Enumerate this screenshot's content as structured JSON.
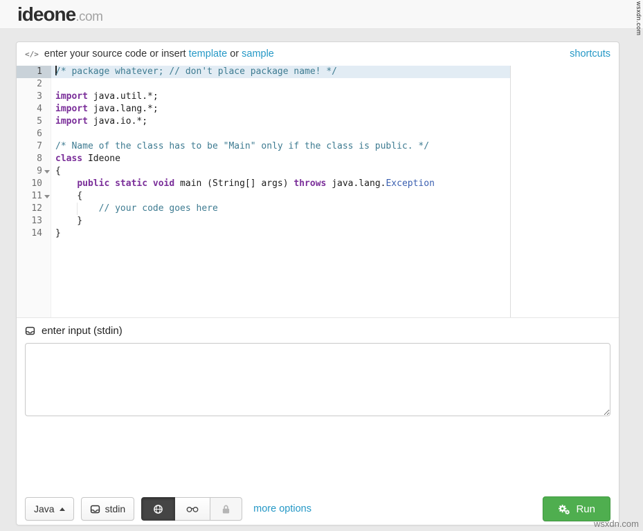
{
  "watermark": {
    "text": "wsxdn.com"
  },
  "header": {
    "logo_main": "ideone",
    "logo_suffix": ".com"
  },
  "source_bar": {
    "code_icon": "</>",
    "prefix": "enter your source code or insert",
    "template_link": "template",
    "or_text": "or",
    "sample_link": "sample",
    "shortcuts_link": "shortcuts"
  },
  "editor": {
    "language": "java",
    "lines": [
      {
        "n": 1,
        "active": true,
        "cursor": true,
        "tokens": [
          {
            "t": "/* package whatever; // don't place package name! */",
            "c": "com"
          }
        ]
      },
      {
        "n": 2,
        "tokens": []
      },
      {
        "n": 3,
        "tokens": [
          {
            "t": "import",
            "c": "kw"
          },
          {
            "t": " java.util.*;",
            "c": "pl"
          }
        ]
      },
      {
        "n": 4,
        "tokens": [
          {
            "t": "import",
            "c": "kw"
          },
          {
            "t": " java.lang.*;",
            "c": "pl"
          }
        ]
      },
      {
        "n": 5,
        "tokens": [
          {
            "t": "import",
            "c": "kw"
          },
          {
            "t": " java.io.*;",
            "c": "pl"
          }
        ]
      },
      {
        "n": 6,
        "tokens": []
      },
      {
        "n": 7,
        "tokens": [
          {
            "t": "/* Name of the class has to be \"Main\" only if the class is public. */",
            "c": "com"
          }
        ]
      },
      {
        "n": 8,
        "tokens": [
          {
            "t": "class",
            "c": "kw"
          },
          {
            "t": " Ideone",
            "c": "pl"
          }
        ]
      },
      {
        "n": 9,
        "fold": true,
        "tokens": [
          {
            "t": "{",
            "c": "pl"
          }
        ]
      },
      {
        "n": 10,
        "tokens": [
          {
            "t": "    ",
            "c": "pl"
          },
          {
            "t": "public",
            "c": "kw"
          },
          {
            "t": " ",
            "c": "pl"
          },
          {
            "t": "static",
            "c": "kw"
          },
          {
            "t": " ",
            "c": "pl"
          },
          {
            "t": "void",
            "c": "kw"
          },
          {
            "t": " main (String[] args) ",
            "c": "pl"
          },
          {
            "t": "throws",
            "c": "kw"
          },
          {
            "t": " java.lang.",
            "c": "pl"
          },
          {
            "t": "Exception",
            "c": "ty"
          }
        ]
      },
      {
        "n": 11,
        "fold": true,
        "tokens": [
          {
            "t": "    {",
            "c": "pl"
          }
        ]
      },
      {
        "n": 12,
        "tokens": [
          {
            "t": "        ",
            "c": "pl"
          },
          {
            "t": "// your code goes here",
            "c": "com"
          }
        ]
      },
      {
        "n": 13,
        "tokens": [
          {
            "t": "    }",
            "c": "pl"
          }
        ]
      },
      {
        "n": 14,
        "tokens": [
          {
            "t": "}",
            "c": "pl"
          }
        ]
      }
    ]
  },
  "stdin": {
    "icon": "inbox-icon",
    "label": "enter input (stdin)",
    "value": ""
  },
  "toolbar": {
    "language_button_label": "Java",
    "stdin_button_label": "stdin",
    "visibility_options": [
      "public",
      "unlisted",
      "private"
    ],
    "visibility_selected": "public",
    "more_options_link": "more options",
    "run_button_label": "Run"
  },
  "colors": {
    "link": "#2598c6",
    "keyword": "#7a2e99",
    "comment": "#3e7b91",
    "type": "#3a5fb0",
    "code_text": "#1c1c1c",
    "active_line_bg": "#e2ecf4",
    "active_gutter_bg": "#c9d2d9",
    "run_button_bg": "#4fae4f",
    "run_button_border": "#3f9a3f"
  }
}
